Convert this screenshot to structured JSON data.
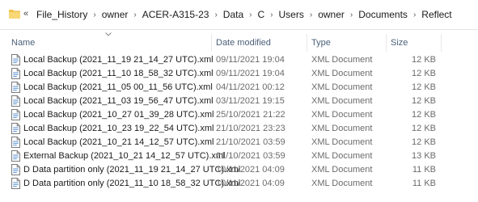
{
  "breadcrumb": {
    "items": [
      "File_History",
      "owner",
      "ACER-A315-23",
      "Data",
      "C",
      "Users",
      "owner",
      "Documents",
      "Reflect"
    ]
  },
  "columns": {
    "name": "Name",
    "date": "Date modified",
    "type": "Type",
    "size": "Size"
  },
  "files": [
    {
      "name": "Local Backup (2021_11_19 21_14_27 UTC).xml",
      "date": "09/11/2021 19:04",
      "type": "XML Document",
      "size": "12 KB"
    },
    {
      "name": "Local Backup (2021_11_10 18_58_32 UTC).xml",
      "date": "09/11/2021 19:04",
      "type": "XML Document",
      "size": "12 KB"
    },
    {
      "name": "Local Backup (2021_11_05 00_11_56 UTC).xml",
      "date": "04/11/2021 00:12",
      "type": "XML Document",
      "size": "12 KB"
    },
    {
      "name": "Local Backup (2021_11_03 19_56_47 UTC).xml",
      "date": "03/11/2021 19:15",
      "type": "XML Document",
      "size": "12 KB"
    },
    {
      "name": "Local Backup (2021_10_27 01_39_28 UTC).xml",
      "date": "25/10/2021 21:22",
      "type": "XML Document",
      "size": "12 KB"
    },
    {
      "name": "Local Backup (2021_10_23 19_22_54 UTC).xml",
      "date": "21/10/2021 23:23",
      "type": "XML Document",
      "size": "12 KB"
    },
    {
      "name": "Local Backup (2021_10_21 14_12_57 UTC).xml",
      "date": "21/10/2021 03:59",
      "type": "XML Document",
      "size": "12 KB"
    },
    {
      "name": "External Backup (2021_10_21 14_12_57 UTC).xml",
      "date": "21/10/2021 03:59",
      "type": "XML Document",
      "size": "13 KB"
    },
    {
      "name": "D Data partition only (2021_11_19 21_14_27 UTC).xml",
      "date": "10/11/2021 04:09",
      "type": "XML Document",
      "size": "11 KB"
    },
    {
      "name": "D Data partition only (2021_11_10 18_58_32 UTC).xml",
      "date": "10/11/2021 04:09",
      "type": "XML Document",
      "size": "11 KB"
    }
  ]
}
